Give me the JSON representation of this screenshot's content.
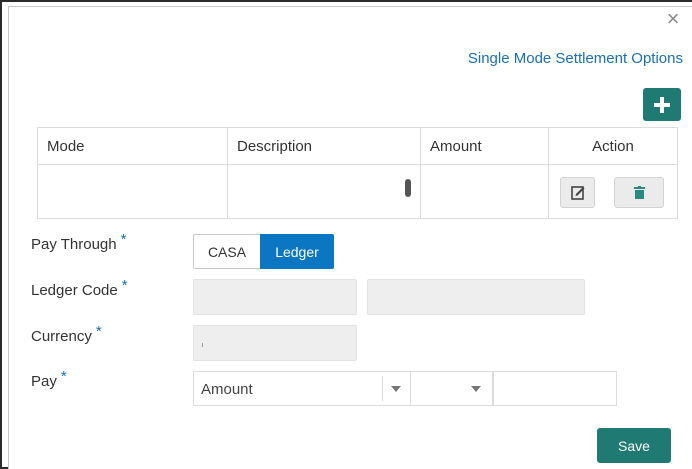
{
  "dialog": {
    "close_symbol": "×",
    "options_link": "Single Mode Settlement Options",
    "add_icon": "plus-icon"
  },
  "table": {
    "columns": [
      "Mode",
      "Description",
      "Amount",
      "Action"
    ],
    "rows": [
      {
        "mode": "",
        "description": "",
        "amount": "",
        "actions": [
          "edit-icon",
          "trash-icon"
        ]
      }
    ]
  },
  "form": {
    "pay_through": {
      "label": "Pay Through",
      "required_marker": "*",
      "options": [
        "CASA",
        "Ledger"
      ],
      "selected": "Ledger"
    },
    "ledger_code": {
      "label": "Ledger Code",
      "required_marker": "*",
      "code_value": "",
      "description_value": ""
    },
    "currency": {
      "label": "Currency",
      "required_marker": "*",
      "value": ""
    },
    "pay": {
      "label": "Pay",
      "required_marker": "*",
      "type_value": "Amount",
      "mode_value": "",
      "amount_value": ""
    }
  },
  "footer": {
    "save_label": "Save"
  },
  "colors": {
    "accent": "#1e7a72",
    "link": "#1a6fb5",
    "toggle_selected": "#0b77c2"
  }
}
